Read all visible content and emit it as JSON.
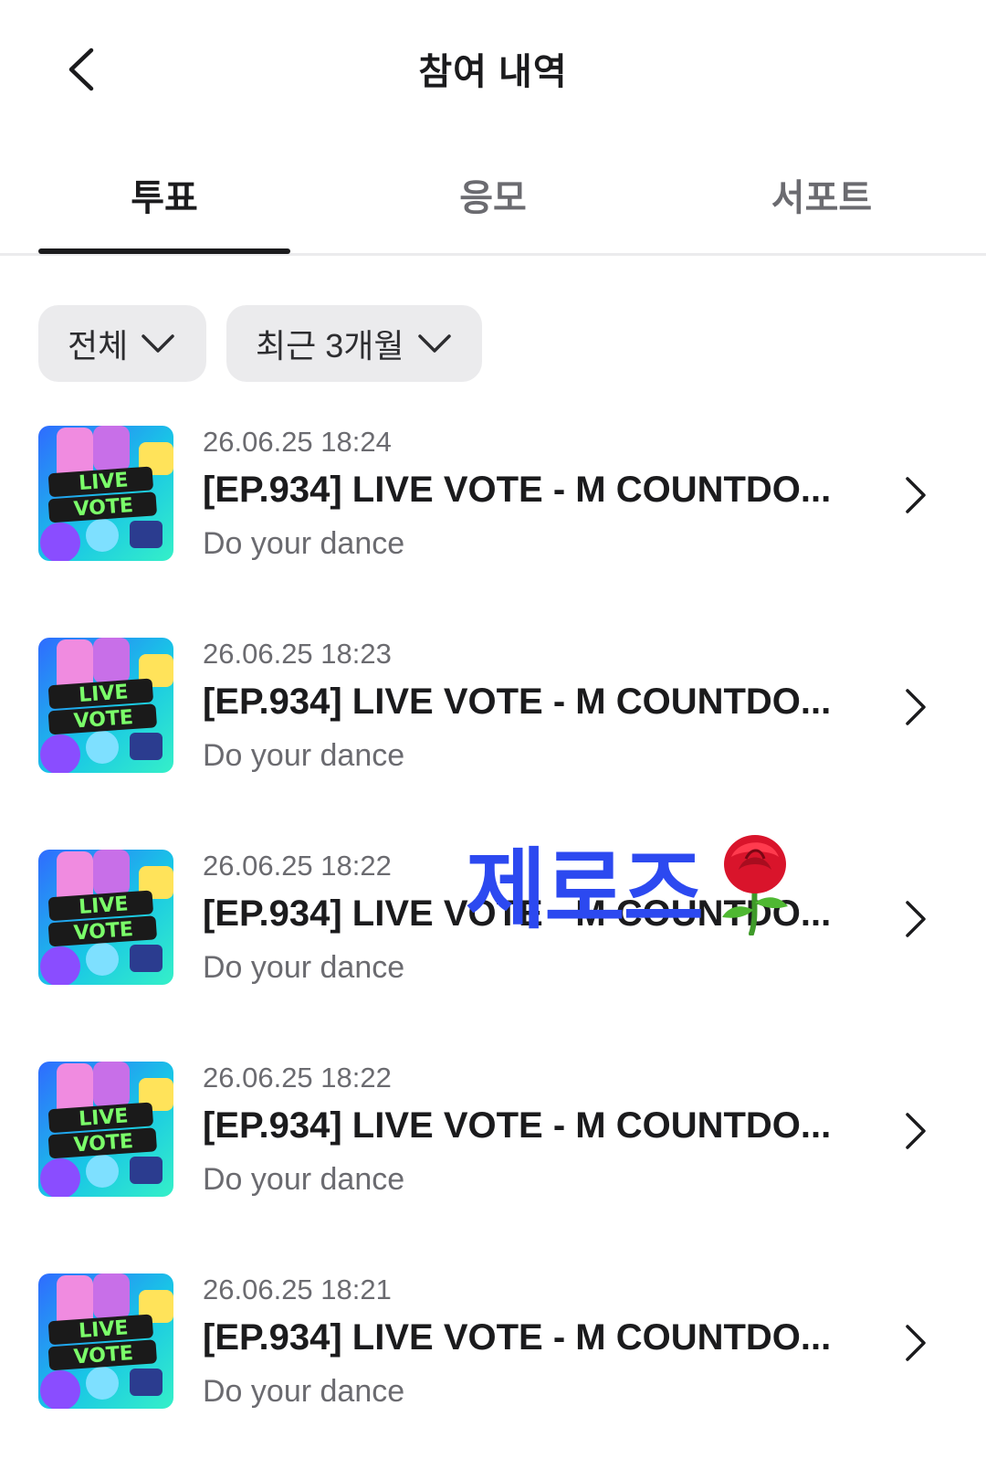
{
  "header": {
    "title": "참여 내역",
    "back_icon": "chevron-left-icon"
  },
  "tabs": [
    {
      "label": "투표",
      "active": true
    },
    {
      "label": "응모",
      "active": false
    },
    {
      "label": "서포트",
      "active": false
    }
  ],
  "filters": [
    {
      "label": "전체",
      "icon": "chevron-down-icon"
    },
    {
      "label": "최근 3개월",
      "icon": "chevron-down-icon"
    }
  ],
  "thumbnail": {
    "line1": "LIVE",
    "line2": "VOTE"
  },
  "items": [
    {
      "date": "26.06.25 18:24",
      "title": "[EP.934] LIVE VOTE - M COUNTDO...",
      "subtitle": "Do your dance"
    },
    {
      "date": "26.06.25 18:23",
      "title": "[EP.934] LIVE VOTE - M COUNTDO...",
      "subtitle": "Do your dance"
    },
    {
      "date": "26.06.25 18:22",
      "title": "[EP.934] LIVE VOTE - M COUNTDO...",
      "subtitle": "Do your dance"
    },
    {
      "date": "26.06.25 18:22",
      "title": "[EP.934] LIVE VOTE - M COUNTDO...",
      "subtitle": "Do your dance"
    },
    {
      "date": "26.06.25 18:21",
      "title": "[EP.934] LIVE VOTE - M COUNTDO...",
      "subtitle": "Do your dance"
    }
  ],
  "watermark": {
    "text": "제로즈",
    "icon": "rose-icon",
    "color": "#2c49f0"
  },
  "colors": {
    "text_primary": "#1b1b1d",
    "text_secondary": "#6b6b70",
    "chip_bg": "#ebebed"
  }
}
